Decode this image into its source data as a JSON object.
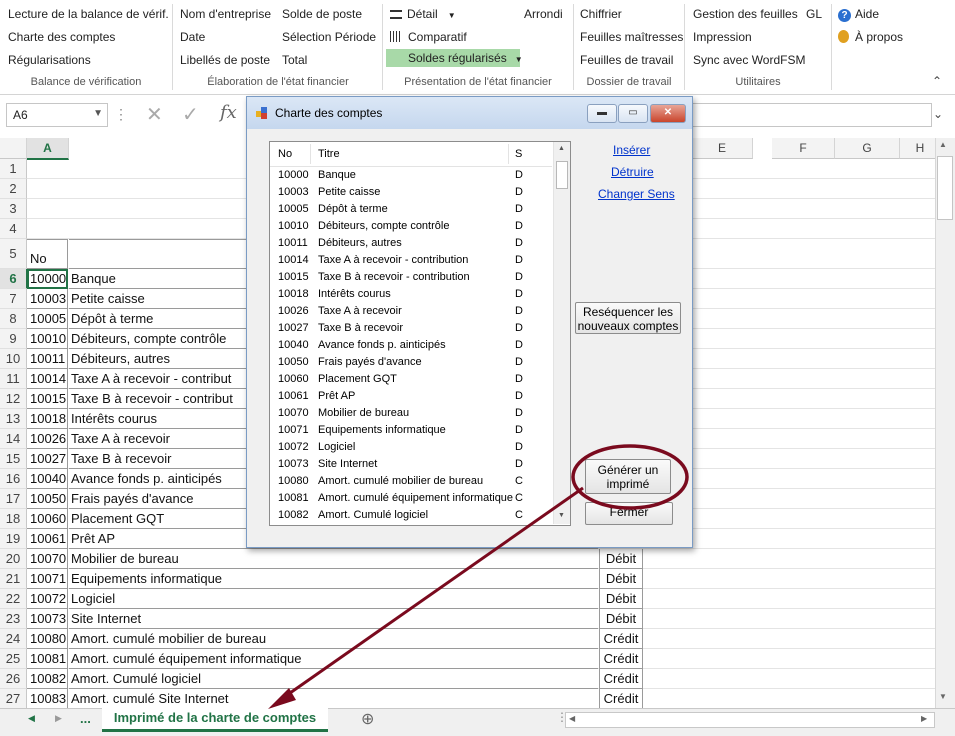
{
  "ribbon": {
    "groups": {
      "balance": {
        "label": "Balance de vérification",
        "items": [
          "Lecture de la balance de vérif.",
          "Charte des comptes",
          "Régularisations"
        ]
      },
      "elaboration": {
        "label": "Élaboration de l'état financier",
        "col1": [
          "Nom d'entreprise",
          "Date",
          "Libellés de poste"
        ],
        "col2": [
          "Solde de poste",
          "Sélection Période",
          "Total"
        ]
      },
      "presentation": {
        "label": "Présentation de l'état financier",
        "detail": "Détail",
        "arrondi": "Arrondi",
        "comparatif": "Comparatif",
        "soldes": "Soldes régularisés"
      },
      "dossier": {
        "label": "Dossier de travail",
        "items": [
          "Chiffrier",
          "Feuilles maîtresses",
          "Feuilles de travail"
        ]
      },
      "utilitaires": {
        "label": "Utilitaires",
        "gestion": "Gestion des feuilles",
        "gl": "GL",
        "impression": "Impression",
        "sync": "Sync avec WordFSM",
        "aide": "Aide",
        "apropos": "À propos"
      }
    }
  },
  "formula_bar": {
    "name_box": "A6",
    "formula": ""
  },
  "grid": {
    "column_a": "A",
    "columns_right": [
      "E",
      "F",
      "G",
      "H"
    ],
    "header_no": "No",
    "rows": [
      {
        "n": "1"
      },
      {
        "n": "2"
      },
      {
        "n": "3"
      },
      {
        "n": "4"
      },
      {
        "n": "5",
        "a": "No"
      },
      {
        "n": "6",
        "a": "10000",
        "b": "Banque"
      },
      {
        "n": "7",
        "a": "10003",
        "b": "Petite caisse"
      },
      {
        "n": "8",
        "a": "10005",
        "b": "Dépôt à terme"
      },
      {
        "n": "9",
        "a": "10010",
        "b": "Débiteurs, compte contrôle"
      },
      {
        "n": "10",
        "a": "10011",
        "b": "Débiteurs, autres"
      },
      {
        "n": "11",
        "a": "10014",
        "b": "Taxe A à recevoir - contribut"
      },
      {
        "n": "12",
        "a": "10015",
        "b": "Taxe B à recevoir - contribut"
      },
      {
        "n": "13",
        "a": "10018",
        "b": "Intérêts courus"
      },
      {
        "n": "14",
        "a": "10026",
        "b": "Taxe A à recevoir"
      },
      {
        "n": "15",
        "a": "10027",
        "b": "Taxe B à recevoir"
      },
      {
        "n": "16",
        "a": "10040",
        "b": "Avance fonds p. ainticipés"
      },
      {
        "n": "17",
        "a": "10050",
        "b": "Frais payés d'avance"
      },
      {
        "n": "18",
        "a": "10060",
        "b": "Placement GQT"
      },
      {
        "n": "19",
        "a": "10061",
        "b": "Prêt AP"
      },
      {
        "n": "20",
        "a": "10070",
        "b": "Mobilier de bureau",
        "s": "Débit"
      },
      {
        "n": "21",
        "a": "10071",
        "b": "Equipements informatique",
        "s": "Débit"
      },
      {
        "n": "22",
        "a": "10072",
        "b": "Logiciel",
        "s": "Débit"
      },
      {
        "n": "23",
        "a": "10073",
        "b": "Site Internet",
        "s": "Débit"
      },
      {
        "n": "24",
        "a": "10080",
        "b": "Amort. cumulé mobilier de bureau",
        "s": "Crédit"
      },
      {
        "n": "25",
        "a": "10081",
        "b": "Amort. cumulé équipement informatique",
        "s": "Crédit"
      },
      {
        "n": "26",
        "a": "10082",
        "b": "Amort. Cumulé logiciel",
        "s": "Crédit"
      },
      {
        "n": "27",
        "a": "10083",
        "b": "Amort. cumulé Site Internet",
        "s": "Crédit"
      }
    ]
  },
  "tabs": {
    "ellipsis": "...",
    "active": "Imprimé de la charte de comptes",
    "add": "⊕"
  },
  "dialog": {
    "title": "Charte des comptes",
    "headers": {
      "no": "No",
      "titre": "Titre",
      "s": "S"
    },
    "items": [
      {
        "no": "10000",
        "titre": "Banque",
        "s": "D"
      },
      {
        "no": "10003",
        "titre": "Petite caisse",
        "s": "D"
      },
      {
        "no": "10005",
        "titre": "Dépôt à terme",
        "s": "D"
      },
      {
        "no": "10010",
        "titre": "Débiteurs, compte contrôle",
        "s": "D"
      },
      {
        "no": "10011",
        "titre": "Débiteurs, autres",
        "s": "D"
      },
      {
        "no": "10014",
        "titre": "Taxe A à recevoir - contribution",
        "s": "D"
      },
      {
        "no": "10015",
        "titre": "Taxe B à recevoir - contribution",
        "s": "D"
      },
      {
        "no": "10018",
        "titre": "Intérêts courus",
        "s": "D"
      },
      {
        "no": "10026",
        "titre": "Taxe A à recevoir",
        "s": "D"
      },
      {
        "no": "10027",
        "titre": "Taxe B à recevoir",
        "s": "D"
      },
      {
        "no": "10040",
        "titre": "Avance fonds p. ainticipés",
        "s": "D"
      },
      {
        "no": "10050",
        "titre": "Frais payés d'avance",
        "s": "D"
      },
      {
        "no": "10060",
        "titre": "Placement GQT",
        "s": "D"
      },
      {
        "no": "10061",
        "titre": "Prêt AP",
        "s": "D"
      },
      {
        "no": "10070",
        "titre": "Mobilier de bureau",
        "s": "D"
      },
      {
        "no": "10071",
        "titre": "Equipements informatique",
        "s": "D"
      },
      {
        "no": "10072",
        "titre": "Logiciel",
        "s": "D"
      },
      {
        "no": "10073",
        "titre": "Site Internet",
        "s": "D"
      },
      {
        "no": "10080",
        "titre": "Amort. cumulé mobilier de bureau",
        "s": "C"
      },
      {
        "no": "10081",
        "titre": "Amort. cumulé équipement informatique",
        "s": "C"
      },
      {
        "no": "10082",
        "titre": "Amort. Cumulé logiciel",
        "s": "C"
      }
    ],
    "links": {
      "inserer": "Insérer",
      "detruire": "Détruire",
      "changer": "Changer Sens"
    },
    "buttons": {
      "resequencer_1": "Reséquencer les",
      "resequencer_2": "nouveaux comptes",
      "generer_1": "Générer un",
      "generer_2": "imprimé",
      "fermer": "Fermer"
    }
  },
  "colors": {
    "excel_green": "#217346",
    "annotation": "#7a0a1e",
    "highlight": "#a8d9a8"
  }
}
